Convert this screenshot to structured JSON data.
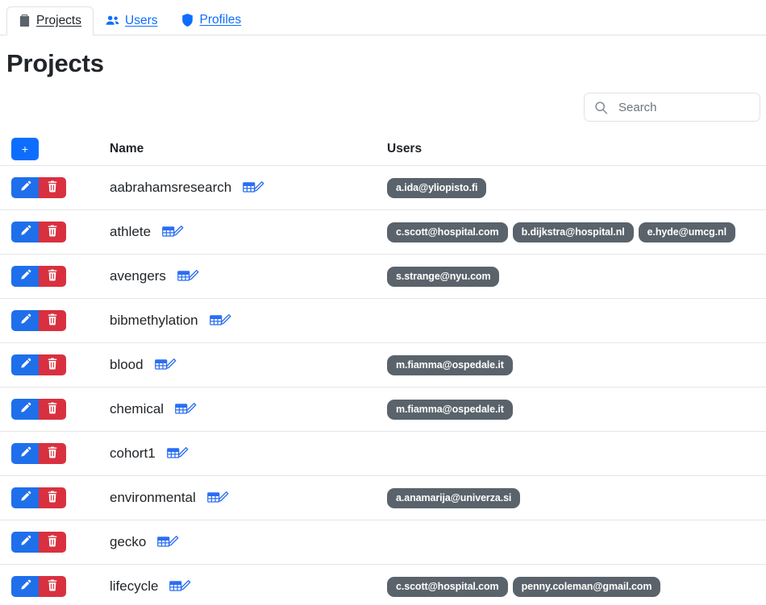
{
  "tabs": [
    {
      "label": "Projects",
      "icon": "chart-clipboard-icon",
      "active": true
    },
    {
      "label": "Users",
      "icon": "people-icon",
      "active": false
    },
    {
      "label": "Profiles",
      "icon": "shield-icon",
      "active": false
    }
  ],
  "page": {
    "title": "Projects"
  },
  "search": {
    "value": "",
    "placeholder": "Search",
    "icon": "search-icon"
  },
  "toolbar": {
    "add_label": "+"
  },
  "table": {
    "columns": [
      "",
      "Name",
      "Users"
    ],
    "row_icons": {
      "edit": "pencil-icon",
      "delete": "trash-icon",
      "data": "table-grid-edit-icon"
    },
    "rows": [
      {
        "name": "aabrahamsresearch",
        "users": [
          "a.ida@yliopisto.fi"
        ]
      },
      {
        "name": "athlete",
        "users": [
          "c.scott@hospital.com",
          "b.dijkstra@hospital.nl",
          "e.hyde@umcg.nl"
        ]
      },
      {
        "name": "avengers",
        "users": [
          "s.strange@nyu.com"
        ]
      },
      {
        "name": "bibmethylation",
        "users": []
      },
      {
        "name": "blood",
        "users": [
          "m.fiamma@ospedale.it"
        ]
      },
      {
        "name": "chemical",
        "users": [
          "m.fiamma@ospedale.it"
        ]
      },
      {
        "name": "cohort1",
        "users": []
      },
      {
        "name": "environmental",
        "users": [
          "a.anamarija@univerza.si"
        ]
      },
      {
        "name": "gecko",
        "users": []
      },
      {
        "name": "lifecycle",
        "users": [
          "c.scott@hospital.com",
          "penny.coleman@gmail.com"
        ]
      }
    ]
  },
  "colors": {
    "accent": "#0d6efd",
    "edit": "#1f6feb",
    "delete": "#d9303f",
    "badge": "#5a636b",
    "border": "#dee2e6",
    "text": "#212529"
  }
}
